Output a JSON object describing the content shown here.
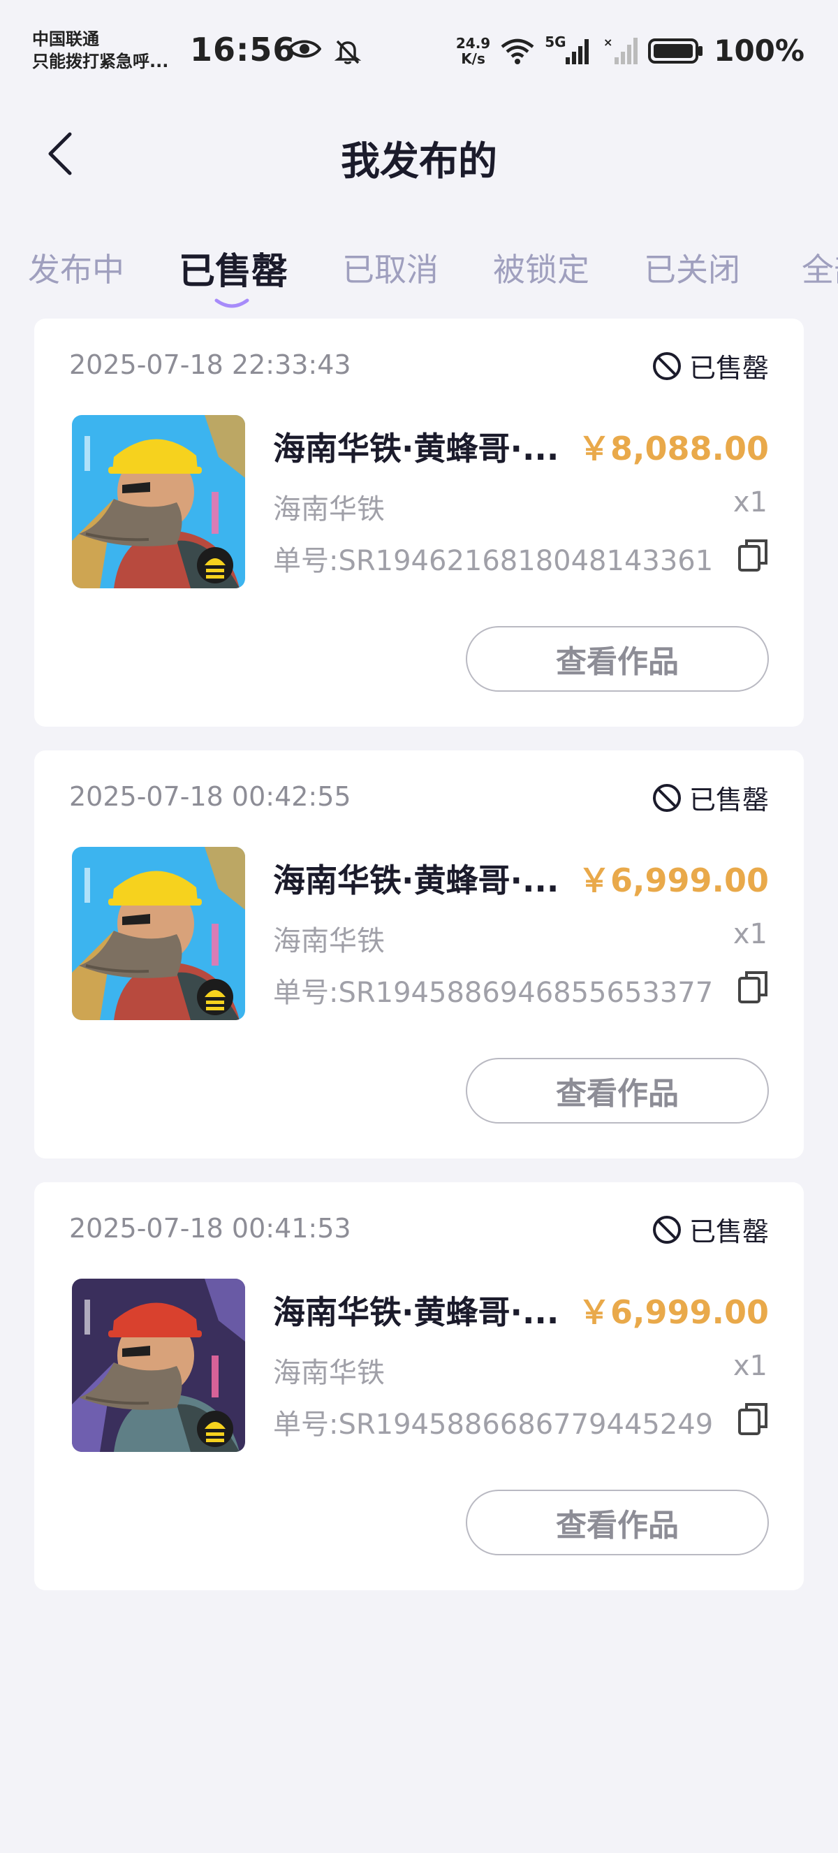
{
  "status_bar": {
    "carrier_line1": "中国联通",
    "carrier_line2": "只能拨打紧急呼...",
    "time": "16:56",
    "net_speed_value": "24.9",
    "net_speed_unit": "K/s",
    "network_type": "5G",
    "battery": "100%"
  },
  "header": {
    "title": "我发布的"
  },
  "tabs": [
    {
      "label": "发布中",
      "active": false
    },
    {
      "label": "已售罄",
      "active": true
    },
    {
      "label": "已取消",
      "active": false
    },
    {
      "label": "被锁定",
      "active": false
    },
    {
      "label": "已关闭",
      "active": false
    },
    {
      "label": "全部",
      "active": false
    }
  ],
  "orders": [
    {
      "time": "2025-07-18 22:33:43",
      "status": "已售罄",
      "name": "海南华铁·黄蜂哥·...",
      "price": "￥8,088.00",
      "publisher": "海南华铁",
      "quantity": "x1",
      "order_no": "单号:SR1946216818048143361",
      "action": "查看作品",
      "thumb_variant": "yellow-helmet"
    },
    {
      "time": "2025-07-18 00:42:55",
      "status": "已售罄",
      "name": "海南华铁·黄蜂哥·...",
      "price": "￥6,999.00",
      "publisher": "海南华铁",
      "quantity": "x1",
      "order_no": "单号:SR1945886946855653377",
      "action": "查看作品",
      "thumb_variant": "yellow-helmet"
    },
    {
      "time": "2025-07-18 00:41:53",
      "status": "已售罄",
      "name": "海南华铁·黄蜂哥·...",
      "price": "￥6,999.00",
      "publisher": "海南华铁",
      "quantity": "x1",
      "order_no": "单号:SR1945886686779445249",
      "action": "查看作品",
      "thumb_variant": "red-helmet"
    }
  ],
  "colors": {
    "background": "#f3f3f8",
    "price": "#e9a94a",
    "tab_inactive": "#9f9fbe",
    "tab_indicator": "#a78bfa",
    "text_primary": "#1b1b2b",
    "text_secondary": "#a0a0a8"
  }
}
